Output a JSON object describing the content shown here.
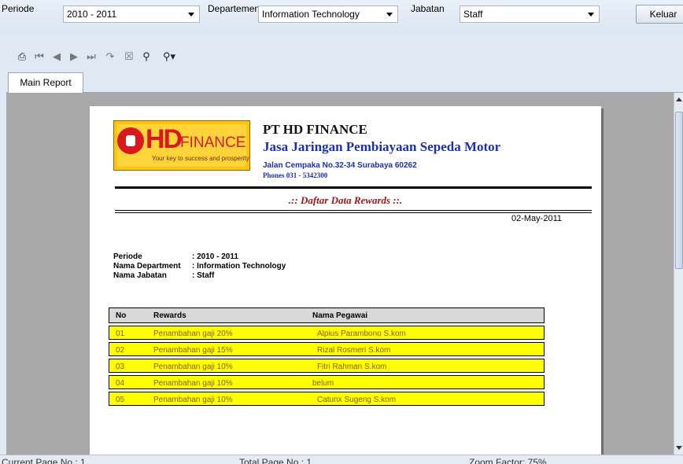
{
  "filters": {
    "periode_label": "Periode",
    "periode_value": "2010 - 2011",
    "departemen_label": "Departemen",
    "departemen_value": "Information Technology",
    "jabatan_label": "Jabatan",
    "jabatan_value": "Staff",
    "exit_label": "Keluar"
  },
  "toolbar": {
    "icons": [
      "print-icon",
      "first-page-icon",
      "previous-page-icon",
      "next-page-icon",
      "last-page-icon",
      "goto-page-icon",
      "close-view-icon",
      "find-icon",
      "zoom-icon"
    ]
  },
  "tabs": {
    "main_report": "Main Report"
  },
  "report": {
    "company": "PT HD FINANCE",
    "slogan": "Jasa Jaringan Pembiayaan Sepeda Motor",
    "address": "Jalan Cempaka No.32-34 Surabaya 60262",
    "phone": "Phones 031 - 5342300",
    "logo": {
      "hd": "HD",
      "finance": "FINANCE",
      "tagline": "Your key to success and prosperity"
    },
    "title": ".:: Daftar Data Rewards ::.",
    "date": "02-May-2011",
    "info": {
      "periode_key": "Periode",
      "periode_val": ": 2010 - 2011",
      "dept_key": "Nama Department",
      "dept_val": ": Information Technology",
      "jabatan_key": "Nama Jabatan",
      "jabatan_val": ": Staff"
    },
    "table": {
      "headers": [
        "No",
        "Rewards",
        "Nama Pegawai"
      ],
      "rows": [
        [
          "01",
          "Penambahan gaji 20%",
          "Alpius Parambono S.kom"
        ],
        [
          "02",
          "Penambahan gaji 15%",
          "Rizal Rosmeri S.kom"
        ],
        [
          "03",
          "Penambahan gaji 10%",
          "Fitri Rahman S.kom"
        ],
        [
          "04",
          "Penambahan gaji 10%",
          "belum"
        ],
        [
          "05",
          "Penambahan gaji 10%",
          "Catunx Sugeng S.kom"
        ]
      ]
    }
  },
  "status": {
    "current_page": "Current Page No.: 1",
    "total_page": "Total Page No.: 1",
    "zoom": "Zoom Factor: 75%"
  },
  "colors": {
    "row_highlight": "#ffff00",
    "slogan": "#1c2fb0",
    "title": "#a01818",
    "brand_red": "#d71920"
  }
}
